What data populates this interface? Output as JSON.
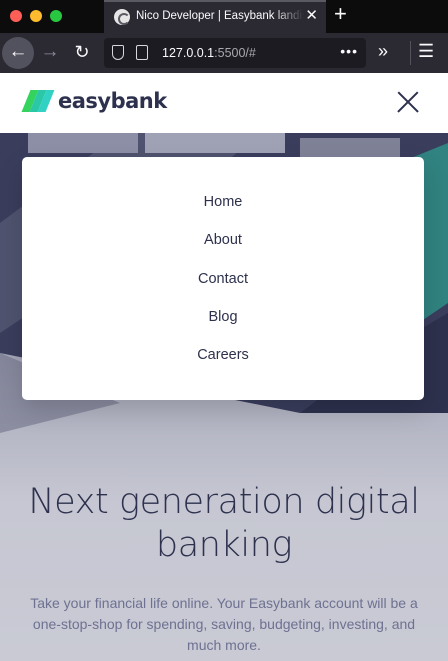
{
  "browser": {
    "tab_title": "Nico Developer | Easybank landing page",
    "tab_close": "✕",
    "new_tab": "+",
    "url_host": "127.0.0.1",
    "url_rest": ":5500/#",
    "page_actions": "•••",
    "overflow": "»",
    "menu": "☰",
    "back": "←",
    "forward": "→",
    "reload": "↻"
  },
  "site": {
    "logo_text": "easybank",
    "brand_colors": {
      "dark_blue": "#2d314d",
      "lime_green": "#31d35c",
      "bright_cyan": "#2bb7da"
    }
  },
  "mobile_menu": {
    "items": [
      "Home",
      "About",
      "Contact",
      "Blog",
      "Careers"
    ]
  },
  "hero": {
    "title": "Next generation digital banking",
    "description": "Take your financial life online. Your Easybank account will be a one-stop-shop for spending, saving, budgeting, investing, and much more."
  }
}
